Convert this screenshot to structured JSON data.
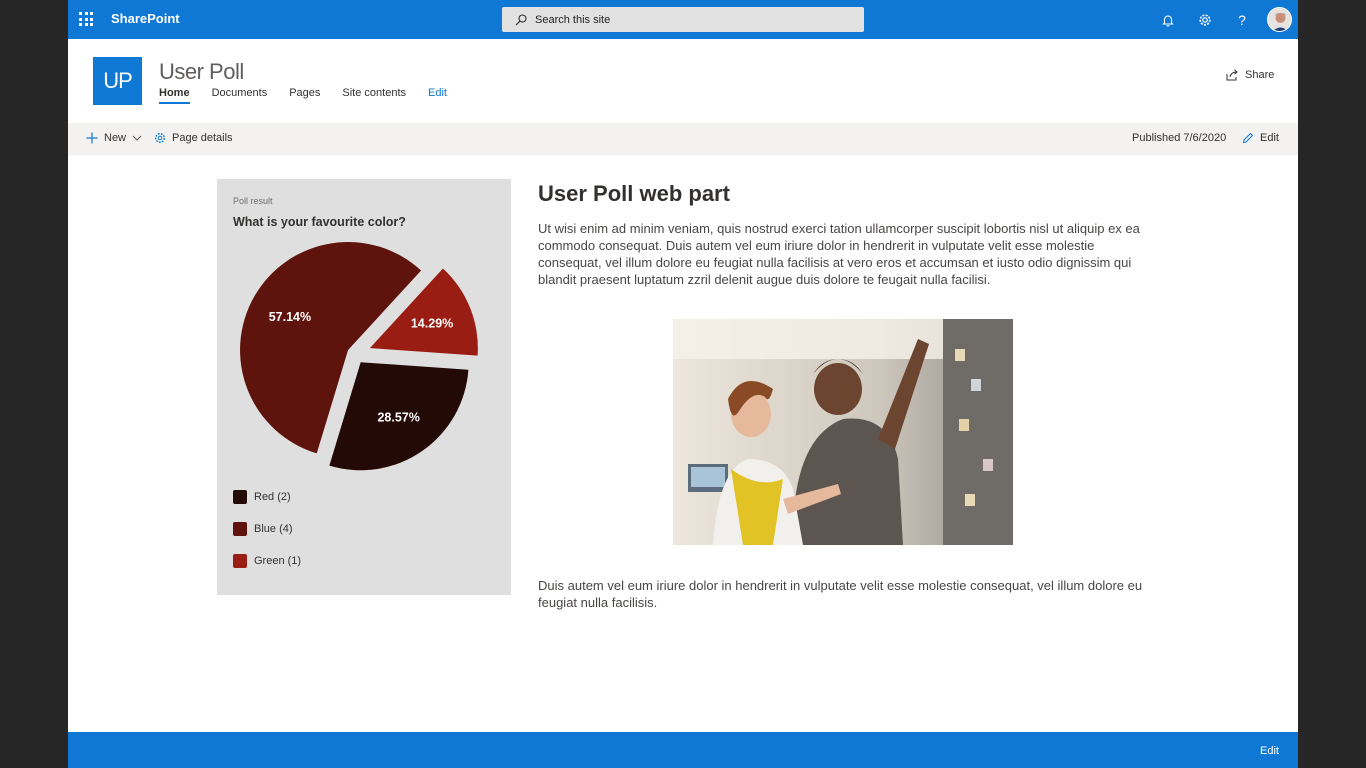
{
  "suite": {
    "app_name": "SharePoint",
    "search_placeholder": "Search this site",
    "icons": [
      "app-launcher-icon",
      "search-icon",
      "bell-icon",
      "gear-icon",
      "help-icon",
      "avatar"
    ]
  },
  "site": {
    "logo_text": "UP",
    "title": "User Poll",
    "nav": [
      {
        "label": "Home",
        "active": true
      },
      {
        "label": "Documents"
      },
      {
        "label": "Pages"
      },
      {
        "label": "Site contents"
      },
      {
        "label": "Edit"
      }
    ],
    "share_label": "Share"
  },
  "commandbar": {
    "new_label": "New",
    "page_details_label": "Page details",
    "published": "Published 7/6/2020",
    "edit_label": "Edit"
  },
  "poll": {
    "kicker": "Poll result",
    "question": "What is your favourite color?",
    "legend": [
      {
        "label": "Red (2)",
        "color": "#240a06"
      },
      {
        "label": "Blue (4)",
        "color": "#5e130d"
      },
      {
        "label": "Green (1)",
        "color": "#991d12"
      }
    ]
  },
  "chart_data": {
    "type": "pie",
    "title": "What is your favourite color?",
    "categories": [
      "Red",
      "Blue",
      "Green"
    ],
    "values": [
      2,
      4,
      1
    ],
    "slice_labels": [
      "28.57%",
      "57.14%",
      "14.29%"
    ],
    "colors": [
      "#240a06",
      "#5e130d",
      "#991d12"
    ],
    "legend_placement": "bottom"
  },
  "article": {
    "title": "User Poll web part",
    "para1": "Ut wisi enim ad minim veniam, quis nostrud exerci tation ullamcorper suscipit lobortis nisl ut aliquip ex ea commodo consequat. Duis autem vel eum iriure dolor in hendrerit in vulputate velit esse molestie consequat, vel illum dolore eu feugiat nulla facilisis at vero eros et accumsan et iusto odio dignissim qui blandit praesent luptatum zzril delenit augue duis dolore te feugait nulla facilisi.",
    "para2": "Duis autem vel eum iriure dolor in hendrerit in vulputate velit esse molestie consequat, vel illum dolore eu feugiat nulla facilisis."
  },
  "footer": {
    "edit_label": "Edit"
  }
}
